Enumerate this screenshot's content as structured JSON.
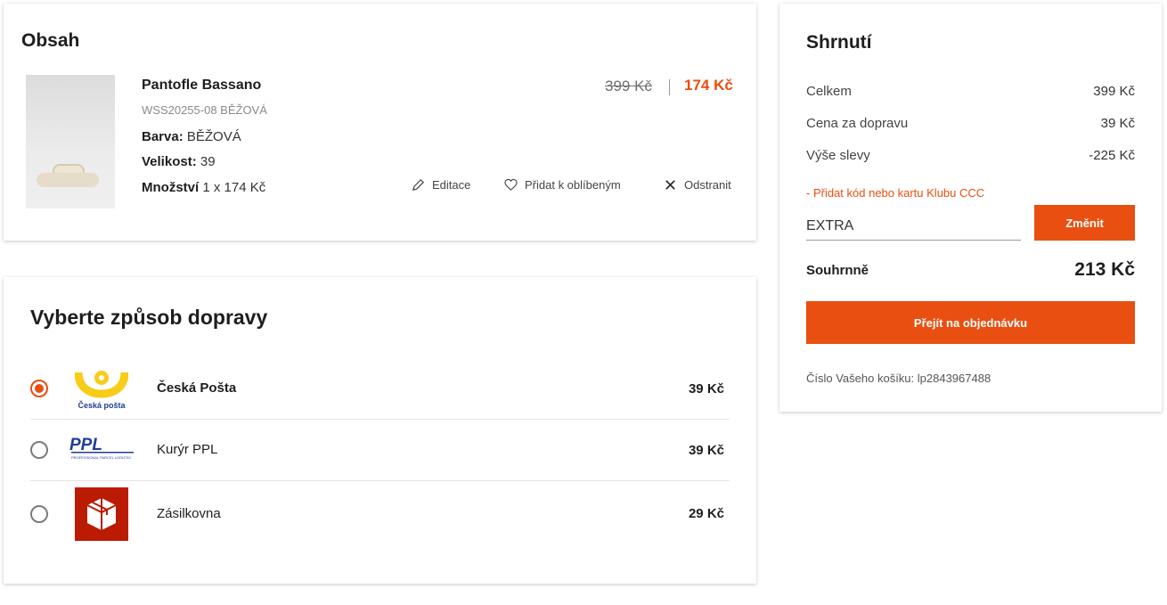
{
  "cart": {
    "title": "Obsah",
    "product": {
      "name": "Pantofle Bassano",
      "code": "WSS20255-08 BĚŽOVÁ",
      "color_label": "Barva:",
      "color_value": "BĚŽOVÁ",
      "size_label": "Velikost:",
      "size_value": "39",
      "qty_label": "Množství",
      "qty_value": "1 x 174 Kč",
      "price_old": "399 Kč",
      "price_new": "174 Kč"
    },
    "actions": {
      "edit": "Editace",
      "favorite": "Přidat k oblíbeným",
      "remove": "Odstranit"
    }
  },
  "shipping": {
    "title": "Vyberte způsob dopravy",
    "options": [
      {
        "name": "Česká Pošta",
        "price": "39 Kč",
        "selected": true,
        "logo_text": "Česká pošta",
        "icon": "ceska-posta-logo"
      },
      {
        "name": "Kurýr PPL",
        "price": "39 Kč",
        "selected": false,
        "logo_text": "PPL",
        "logo_subtext": "PROFESSIONAL PARCEL LOGISTIC",
        "icon": "ppl-logo"
      },
      {
        "name": "Zásilkovna",
        "price": "29 Kč",
        "selected": false,
        "icon": "zasilkovna-logo"
      }
    ]
  },
  "summary": {
    "title": "Shrnutí",
    "rows": [
      {
        "label": "Celkem",
        "value": "399 Kč"
      },
      {
        "label": "Cena za dopravu",
        "value": "39 Kč"
      },
      {
        "label": "Výše slevy",
        "value": "-225 Kč"
      }
    ],
    "promo_link": "- Přidat kód nebo kartu Klubu CCC",
    "code_value": "EXTRA",
    "change_button": "Změnit",
    "total_label": "Souhrnně",
    "total_value": "213 Kč",
    "order_button": "Přejít na objednávku",
    "cart_number": "Číslo Vašeho košíku: lp2843967488"
  },
  "colors": {
    "accent": "#e84f10",
    "posta_yellow": "#f8cc17",
    "posta_blue": "#1a3e8f",
    "ppl_blue": "#1f3c96",
    "zasilkovna_red": "#ba1b02"
  }
}
